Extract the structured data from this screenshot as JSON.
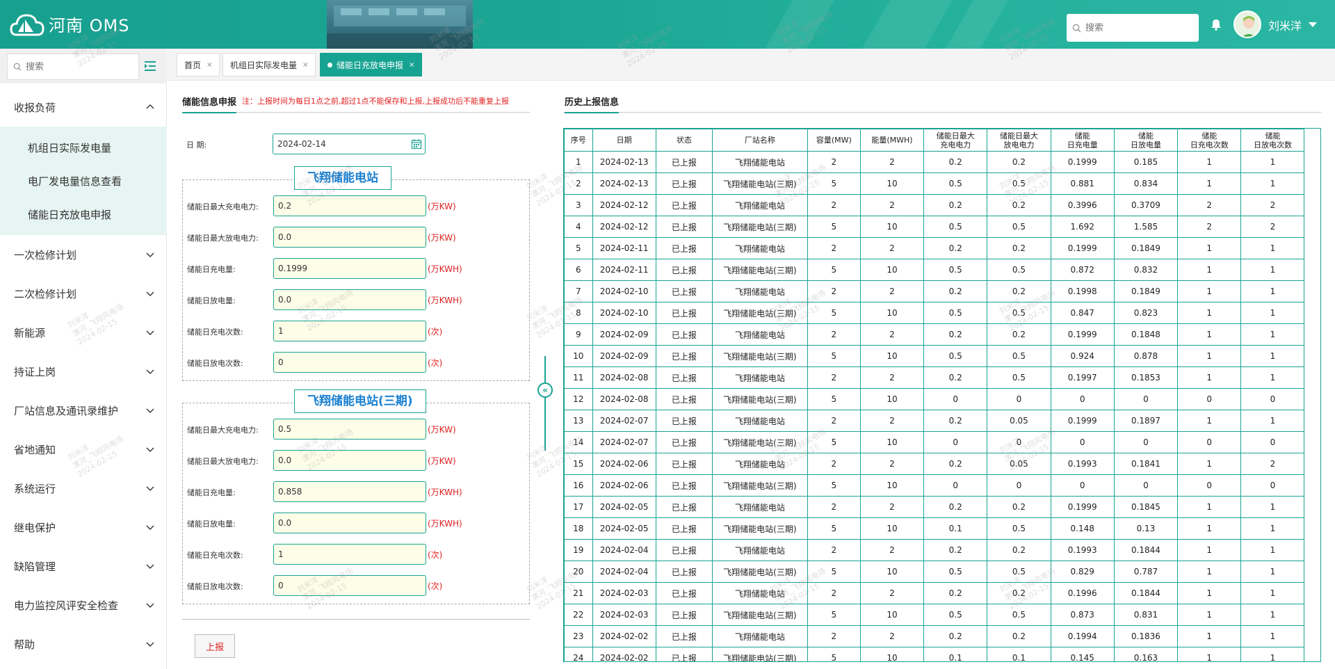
{
  "header": {
    "app_title": "河南 OMS",
    "search_placeholder": "搜索",
    "username": "刘米洋"
  },
  "sidebar": {
    "search_placeholder": "搜索",
    "menu": [
      {
        "label": "收报负荷",
        "expanded": true,
        "children": [
          "机组日实际发电量",
          "电厂发电量信息查看",
          "储能日充放电申报"
        ]
      },
      {
        "label": "一次检修计划"
      },
      {
        "label": "二次检修计划"
      },
      {
        "label": "新能源"
      },
      {
        "label": "持证上岗"
      },
      {
        "label": "厂站信息及通讯录维护"
      },
      {
        "label": "省地通知"
      },
      {
        "label": "系统运行"
      },
      {
        "label": "继电保护"
      },
      {
        "label": "缺陷管理"
      },
      {
        "label": "电力监控风评安全检查"
      },
      {
        "label": "帮助"
      }
    ]
  },
  "tabs": [
    {
      "label": "首页",
      "close": "×"
    },
    {
      "label": "机组日实际发电量",
      "close": "×"
    },
    {
      "label": "储能日充放电申报",
      "close": "×",
      "active": true
    }
  ],
  "form": {
    "title": "储能信息申报",
    "note": "注：上报时间为每日1点之前,超过1点不能保存和上报,上报成功后不能重复上报",
    "date_label": "日  期:",
    "date_value": "2024-02-14",
    "stations": [
      {
        "name": "飞翔储能电站",
        "fields": [
          {
            "label": "储能日最大充电电力:",
            "value": "0.2",
            "unit": "(万KW)"
          },
          {
            "label": "储能日最大放电电力:",
            "value": "0.0",
            "unit": "(万KW)"
          },
          {
            "label": "储能日充电量:",
            "value": "0.1999",
            "unit": "(万KWH)"
          },
          {
            "label": "储能日放电量:",
            "value": "0.0",
            "unit": "(万KWH)"
          },
          {
            "label": "储能日充电次数:",
            "value": "1",
            "unit": "(次)"
          },
          {
            "label": "储能日放电次数:",
            "value": "0",
            "unit": "(次)"
          }
        ]
      },
      {
        "name": "飞翔储能电站(三期)",
        "fields": [
          {
            "label": "储能日最大充电电力:",
            "value": "0.5",
            "unit": "(万KW)"
          },
          {
            "label": "储能日最大放电电力:",
            "value": "0.0",
            "unit": "(万KW)"
          },
          {
            "label": "储能日充电量:",
            "value": "0.858",
            "unit": "(万KWH)"
          },
          {
            "label": "储能日放电量:",
            "value": "0.0",
            "unit": "(万KWH)"
          },
          {
            "label": "储能日充电次数:",
            "value": "1",
            "unit": "(次)"
          },
          {
            "label": "储能日放电次数:",
            "value": "0",
            "unit": "(次)"
          }
        ]
      }
    ],
    "submit_label": "上报"
  },
  "history": {
    "title": "历史上报信息",
    "columns": [
      "序号",
      "日期",
      "状态",
      "厂站名称",
      "容量(MW)",
      "能量(MWH)",
      "储能日最大\n充电电力",
      "储能日最大\n放电电力",
      "储能\n日充电量",
      "储能\n日放电量",
      "储能\n日充电次数",
      "储能\n日放电次数"
    ],
    "rows": [
      [
        "1",
        "2024-02-13",
        "已上报",
        "飞翔储能电站",
        "2",
        "2",
        "0.2",
        "0.2",
        "0.1999",
        "0.185",
        "1",
        "1"
      ],
      [
        "2",
        "2024-02-13",
        "已上报",
        "飞翔储能电站(三期)",
        "5",
        "10",
        "0.5",
        "0.5",
        "0.881",
        "0.834",
        "1",
        "1"
      ],
      [
        "3",
        "2024-02-12",
        "已上报",
        "飞翔储能电站",
        "2",
        "2",
        "0.2",
        "0.2",
        "0.3996",
        "0.3709",
        "2",
        "2"
      ],
      [
        "4",
        "2024-02-12",
        "已上报",
        "飞翔储能电站(三期)",
        "5",
        "10",
        "0.5",
        "0.5",
        "1.692",
        "1.585",
        "2",
        "2"
      ],
      [
        "5",
        "2024-02-11",
        "已上报",
        "飞翔储能电站",
        "2",
        "2",
        "0.2",
        "0.2",
        "0.1999",
        "0.1849",
        "1",
        "1"
      ],
      [
        "6",
        "2024-02-11",
        "已上报",
        "飞翔储能电站(三期)",
        "5",
        "10",
        "0.5",
        "0.5",
        "0.872",
        "0.832",
        "1",
        "1"
      ],
      [
        "7",
        "2024-02-10",
        "已上报",
        "飞翔储能电站",
        "2",
        "2",
        "0.2",
        "0.2",
        "0.1998",
        "0.1849",
        "1",
        "1"
      ],
      [
        "8",
        "2024-02-10",
        "已上报",
        "飞翔储能电站(三期)",
        "5",
        "10",
        "0.5",
        "0.5",
        "0.847",
        "0.823",
        "1",
        "1"
      ],
      [
        "9",
        "2024-02-09",
        "已上报",
        "飞翔储能电站",
        "2",
        "2",
        "0.2",
        "0.2",
        "0.1999",
        "0.1848",
        "1",
        "1"
      ],
      [
        "10",
        "2024-02-09",
        "已上报",
        "飞翔储能电站(三期)",
        "5",
        "10",
        "0.5",
        "0.5",
        "0.924",
        "0.878",
        "1",
        "1"
      ],
      [
        "11",
        "2024-02-08",
        "已上报",
        "飞翔储能电站",
        "2",
        "2",
        "0.2",
        "0.5",
        "0.1997",
        "0.1853",
        "1",
        "1"
      ],
      [
        "12",
        "2024-02-08",
        "已上报",
        "飞翔储能电站(三期)",
        "5",
        "10",
        "0",
        "0",
        "0",
        "0",
        "0",
        "0"
      ],
      [
        "13",
        "2024-02-07",
        "已上报",
        "飞翔储能电站",
        "2",
        "2",
        "0.2",
        "0.05",
        "0.1999",
        "0.1897",
        "1",
        "1"
      ],
      [
        "14",
        "2024-02-07",
        "已上报",
        "飞翔储能电站(三期)",
        "5",
        "10",
        "0",
        "0",
        "0",
        "0",
        "0",
        "0"
      ],
      [
        "15",
        "2024-02-06",
        "已上报",
        "飞翔储能电站",
        "2",
        "2",
        "0.2",
        "0.05",
        "0.1993",
        "0.1841",
        "1",
        "2"
      ],
      [
        "16",
        "2024-02-06",
        "已上报",
        "飞翔储能电站(三期)",
        "5",
        "10",
        "0",
        "0",
        "0",
        "0",
        "0",
        "0"
      ],
      [
        "17",
        "2024-02-05",
        "已上报",
        "飞翔储能电站",
        "2",
        "2",
        "0.2",
        "0.2",
        "0.1999",
        "0.1845",
        "1",
        "1"
      ],
      [
        "18",
        "2024-02-05",
        "已上报",
        "飞翔储能电站(三期)",
        "5",
        "10",
        "0.1",
        "0.5",
        "0.148",
        "0.13",
        "1",
        "1"
      ],
      [
        "19",
        "2024-02-04",
        "已上报",
        "飞翔储能电站",
        "2",
        "2",
        "0.2",
        "0.2",
        "0.1993",
        "0.1844",
        "1",
        "1"
      ],
      [
        "20",
        "2024-02-04",
        "已上报",
        "飞翔储能电站(三期)",
        "5",
        "10",
        "0.5",
        "0.5",
        "0.829",
        "0.787",
        "1",
        "1"
      ],
      [
        "21",
        "2024-02-03",
        "已上报",
        "飞翔储能电站",
        "2",
        "2",
        "0.2",
        "0.2",
        "0.1996",
        "0.1844",
        "1",
        "1"
      ],
      [
        "22",
        "2024-02-03",
        "已上报",
        "飞翔储能电站(三期)",
        "5",
        "10",
        "0.5",
        "0.5",
        "0.873",
        "0.831",
        "1",
        "1"
      ],
      [
        "23",
        "2024-02-02",
        "已上报",
        "飞翔储能电站",
        "2",
        "2",
        "0.2",
        "0.2",
        "0.1994",
        "0.1836",
        "1",
        "1"
      ],
      [
        "24",
        "2024-02-02",
        "已上报",
        "飞翔储能电站(三期)",
        "5",
        "10",
        "0.1",
        "0.1",
        "0.145",
        "0.163",
        "1",
        "1"
      ]
    ]
  },
  "watermark": {
    "line1": "刘米洋",
    "line2": "漯河_飞翔风电场",
    "line3": "2024-02-15"
  },
  "colors": {
    "accent": "#17a392",
    "warning": "#e02020",
    "station_title": "#1a7fd0",
    "input_bg": "#fefde8"
  }
}
